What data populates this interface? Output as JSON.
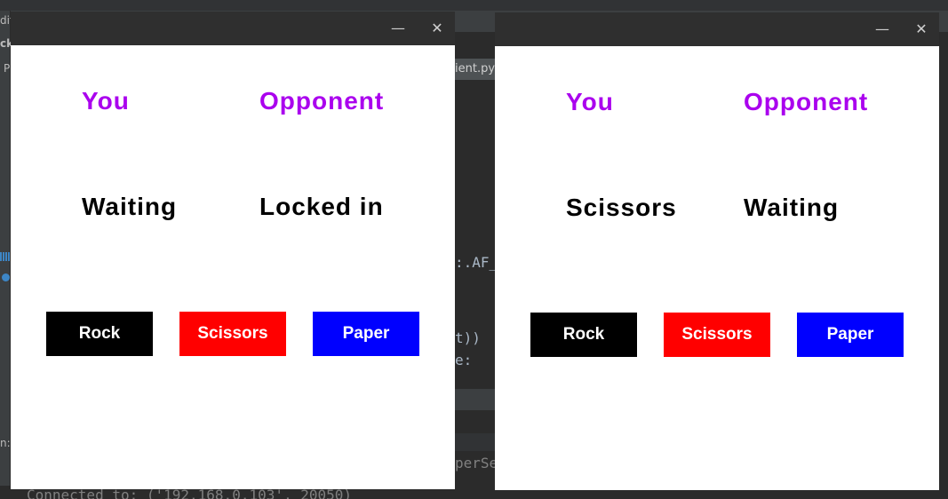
{
  "colors": {
    "heading": "#aa00ee",
    "status_text": "#000000",
    "rock_button": "#000000",
    "scissors_button": "#ff0000",
    "paper_button": "#0000ff",
    "window_bg": "#ffffff",
    "titlebar_bg": "#2f2f2f",
    "ide_bg": "#2b2b2b"
  },
  "icons": {
    "minimize": "minimize-icon",
    "close": "close-icon"
  },
  "ide": {
    "left_fragments": [
      "dit",
      "ck",
      "P",
      "n:"
    ],
    "editor_tab_fragment": "ient.py",
    "code_fragments": [
      ":.AF_",
      "t))",
      "e:",
      "perSe"
    ],
    "console_fragment": "Connected to: ('192.168.0.103', 20050)"
  },
  "windows": [
    {
      "titlebar": {
        "minimize_glyph": "—",
        "close_glyph": "✕"
      },
      "you_label": "You",
      "opponent_label": "Opponent",
      "you_status": "Waiting",
      "opponent_status": "Locked in",
      "buttons": {
        "rock": "Rock",
        "scissors": "Scissors",
        "paper": "Paper"
      }
    },
    {
      "titlebar": {
        "minimize_glyph": "—",
        "close_glyph": "✕"
      },
      "you_label": "You",
      "opponent_label": "Opponent",
      "you_status": "Scissors",
      "opponent_status": "Waiting",
      "buttons": {
        "rock": "Rock",
        "scissors": "Scissors",
        "paper": "Paper"
      }
    }
  ]
}
